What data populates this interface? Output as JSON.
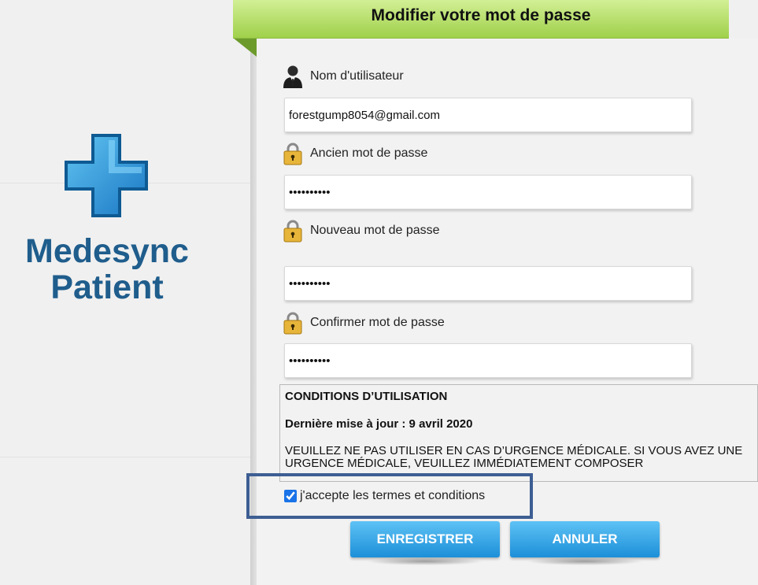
{
  "brand": {
    "line1": "Medesync",
    "line2": "Patient",
    "color": "#1f5d8c"
  },
  "header": {
    "title": "Modifier votre mot de passe"
  },
  "form": {
    "username": {
      "label": "Nom d'utilisateur",
      "value": "forestgump8054@gmail.com",
      "icon": "user-icon"
    },
    "old_password": {
      "label": "Ancien mot de passe",
      "value": "••••••••••",
      "icon": "lock-icon"
    },
    "new_password": {
      "label": "Nouveau mot de passe",
      "value": "••••••••••",
      "icon": "lock-icon"
    },
    "confirm_password": {
      "label": "Confirmer mot de passe",
      "value": "••••••••••",
      "icon": "lock-icon"
    }
  },
  "terms": {
    "title": "CONDITIONS D’UTILISATION",
    "updated": "Dernière mise à jour : 9 avril 2020",
    "body": "VEUILLEZ NE PAS UTILISER EN CAS D’URGENCE MÉDICALE. SI VOUS AVEZ UNE URGENCE MÉDICALE, VEUILLEZ IMMÉDIATEMENT COMPOSER"
  },
  "accept": {
    "label": "j'accepte les termes et conditions",
    "checked": true
  },
  "buttons": {
    "save": "ENREGISTRER",
    "cancel": "ANNULER"
  },
  "colors": {
    "header_green": "#9fd04a",
    "button_blue": "#1c8fd8",
    "highlight_border": "#3d5e93"
  }
}
